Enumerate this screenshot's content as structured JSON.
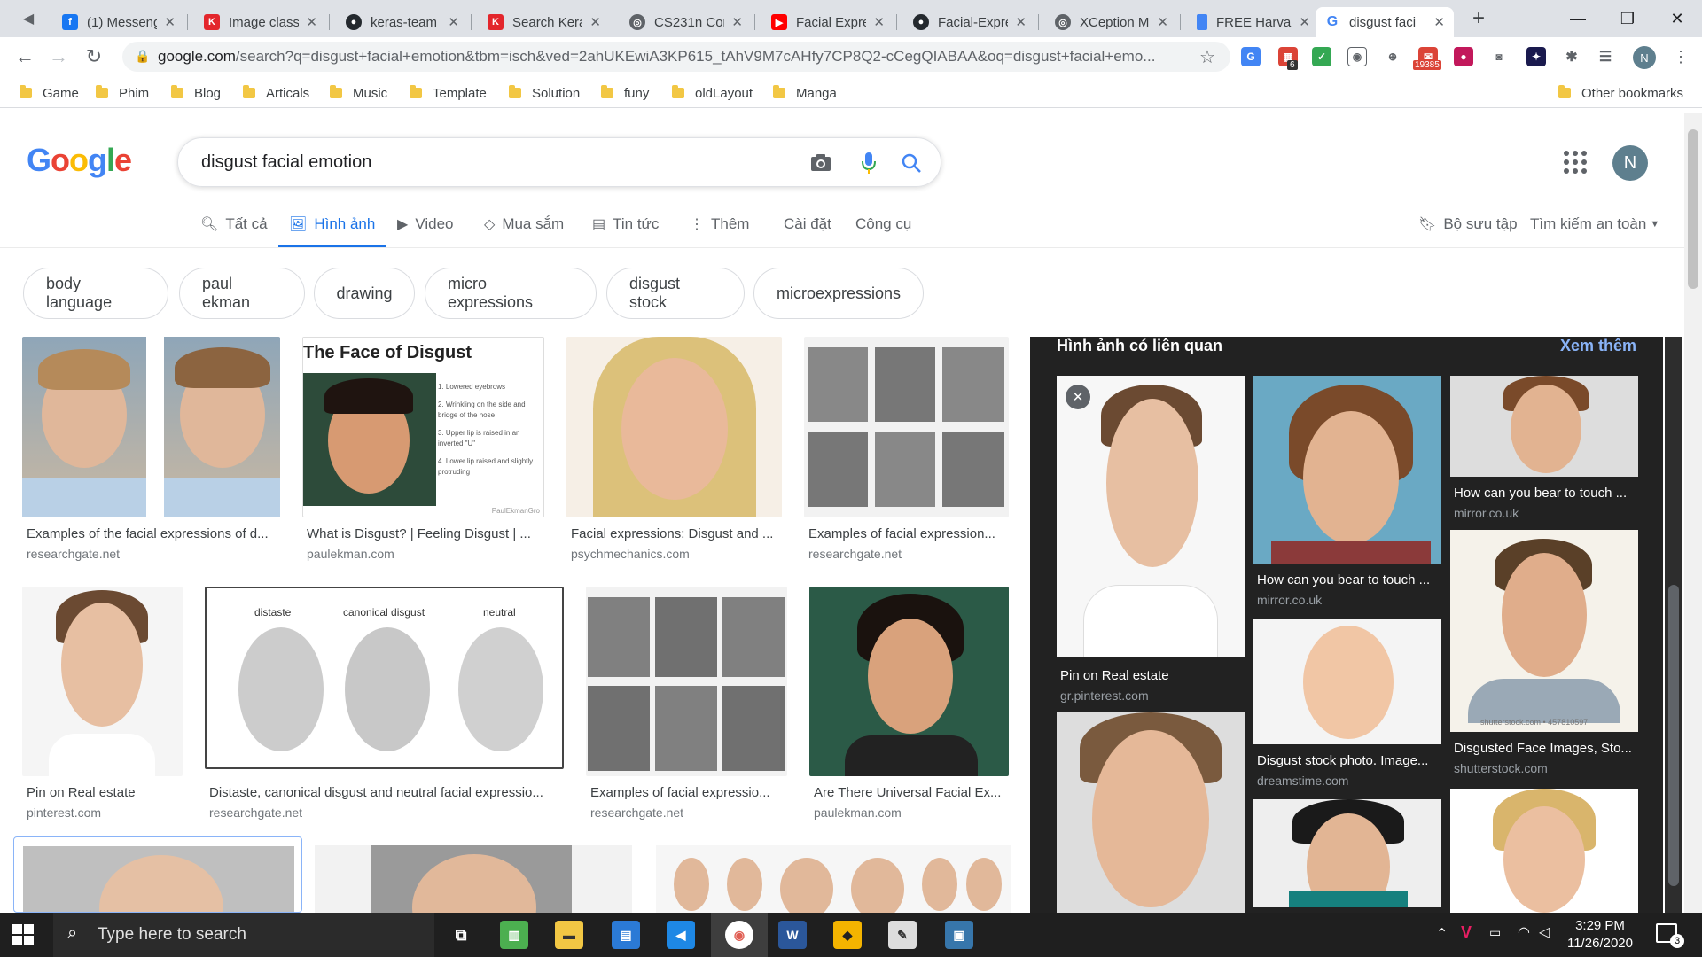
{
  "browser": {
    "tabs": [
      {
        "title": "(1) Messeng",
        "favicon": "facebook-icon",
        "color": "#1877f2"
      },
      {
        "title": "Image class",
        "favicon": "kaggle-icon",
        "color": "#e3262c"
      },
      {
        "title": "keras-team",
        "favicon": "github-icon",
        "color": "#24292e"
      },
      {
        "title": "Search Kera",
        "favicon": "kaggle-icon",
        "color": "#e3262c"
      },
      {
        "title": "CS231n Cor",
        "favicon": "globe-icon",
        "color": "#5f6368"
      },
      {
        "title": "Facial Expre",
        "favicon": "youtube-icon",
        "color": "#ff0000"
      },
      {
        "title": "Facial-Expre",
        "favicon": "github-icon",
        "color": "#24292e"
      },
      {
        "title": "XCeption M",
        "favicon": "globe-icon",
        "color": "#5f6368"
      },
      {
        "title": "FREE Harva",
        "favicon": "bookmark-icon",
        "color": "#4285f4"
      },
      {
        "title": "disgust faci",
        "favicon": "google-icon",
        "color": "#4285f4"
      }
    ],
    "new_tab": "+",
    "url_host": "google.com",
    "url_rest": "/search?q=disgust+facial+emotion&tbm=isch&ved=2ahUKEwiA3KP615_tAhV9M7cAHfy7CP8Q2-cCegQIABAA&oq=disgust+facial+emo...",
    "ext_badges": {
      "ext1": "6",
      "mail": "19385"
    },
    "profile_initial": "N",
    "bookmarks": [
      "Game",
      "Phim",
      "Blog",
      "Articals",
      "Music",
      "Template",
      "Solution",
      "funy",
      "oldLayout",
      "Manga"
    ],
    "other_bookmarks": "Other bookmarks"
  },
  "google": {
    "logo": "Google",
    "query": "disgust facial emotion",
    "nav": [
      {
        "label": "Tất cả",
        "icon": "search-icon"
      },
      {
        "label": "Hình ảnh",
        "icon": "image-icon",
        "active": true
      },
      {
        "label": "Video",
        "icon": "video-icon"
      },
      {
        "label": "Mua sắm",
        "icon": "tag-icon"
      },
      {
        "label": "Tin tức",
        "icon": "news-icon"
      },
      {
        "label": "Thêm",
        "icon": "more-icon"
      }
    ],
    "settings": "Cài đặt",
    "tools": "Công cụ",
    "collections": "Bộ sưu tập",
    "safe_search": "Tìm kiếm an toàn",
    "avatar": "N",
    "chips": [
      "body language",
      "paul ekman",
      "drawing",
      "micro expressions",
      "disgust stock",
      "microexpressions"
    ],
    "results": [
      {
        "caption": "Examples of the facial expressions of d...",
        "source": "researchgate.net"
      },
      {
        "caption": "What is Disgust? | Feeling Disgust | ...",
        "source": "paulekman.com",
        "thumb_title": "The Face of Disgust",
        "notes": [
          "1. Lowered eyebrows",
          "2. Wrinkling on the side and bridge of the nose",
          "3. Upper lip is raised in an inverted \"U\"",
          "4. Lower lip raised and slightly protruding"
        ],
        "watermark": "PaulEkmanGro"
      },
      {
        "caption": "Facial expressions: Disgust and ...",
        "source": "psychmechanics.com"
      },
      {
        "caption": "Examples of facial expression...",
        "source": "researchgate.net"
      },
      {
        "caption": "Pin on Real estate",
        "source": "pinterest.com"
      },
      {
        "caption": "Distaste, canonical disgust and neutral facial expressio...",
        "source": "researchgate.net",
        "labels": [
          "distaste",
          "canonical disgust",
          "neutral"
        ]
      },
      {
        "caption": "Examples of facial expressio...",
        "source": "researchgate.net"
      },
      {
        "caption": "Are There Universal Facial Ex...",
        "source": "paulekman.com"
      }
    ],
    "related": {
      "heading": "Hình ảnh có liên quan",
      "more": "Xem thêm",
      "items": [
        {
          "caption": "Pin on Real estate",
          "source": "gr.pinterest.com"
        },
        {
          "caption": "How can you bear to touch ...",
          "source": "mirror.co.uk"
        },
        {
          "caption": "How can you bear to touch ...",
          "source": "mirror.co.uk"
        },
        {
          "caption": "Disgust stock photo. Image...",
          "source": "dreamstime.com"
        },
        {
          "caption": "Disgusted Face Images, Sto...",
          "source": "shutterstock.com",
          "watermark": "shutterstock.com • 457810597"
        }
      ]
    }
  },
  "taskbar": {
    "search_placeholder": "Type here to search",
    "time": "3:29 PM",
    "date": "11/26/2020",
    "notifications": "3"
  }
}
